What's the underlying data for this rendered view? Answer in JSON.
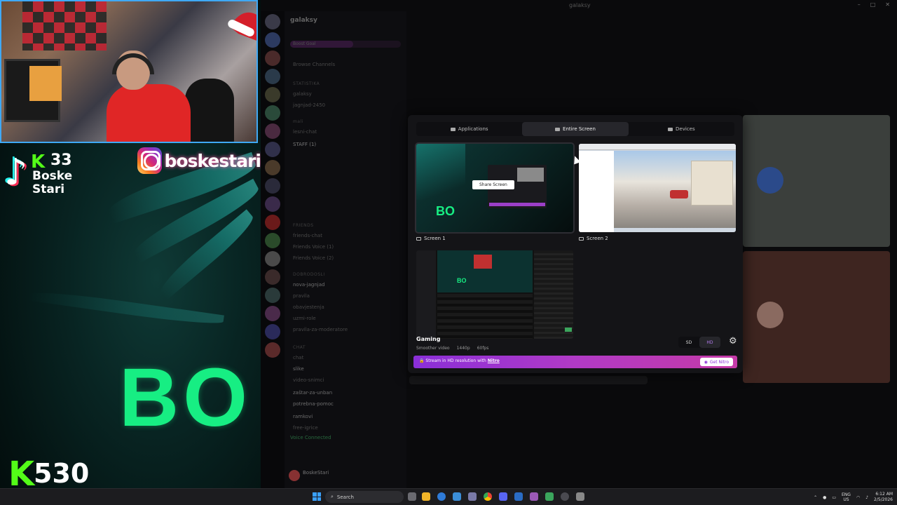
{
  "overlay": {
    "tiktok_logo": "♪",
    "tiktok_k": "K",
    "tiktok_count": "33",
    "tiktok_name": "Boske Stari",
    "instagram_handle": "boskestari",
    "big_logo": "BO",
    "kick_k": "K",
    "kick_count": "530",
    "kick_name": "boskestari",
    "accent_green": "#17ee83"
  },
  "discord": {
    "window_title": "galaksy",
    "server_name": "galaksy",
    "boost_goal": "Boost Goal",
    "channels": [
      "Browse Channels",
      "STATISTIKA",
      "galaksy",
      "jagnjad-2450",
      "mali",
      "lesni-chat",
      "STAFF (1)",
      "FRIENDS",
      "friends-chat",
      "Friends Voice (1)",
      "Friends Voice (2)",
      "DOBRODOSLI",
      "nova-jagnjad",
      "pravila",
      "obavjestenja",
      "uzmi-role",
      "pravila-za-moderatore",
      "CHAT",
      "chat",
      "slike",
      "video-snimci",
      "zaštar-za-unban",
      "potrebna-pomoc",
      "ramkovi",
      "free-igrice"
    ],
    "voice_status": "Voice Connected",
    "user_name": "BoskeStari"
  },
  "modal": {
    "tabs": [
      {
        "label": "Applications",
        "active": false
      },
      {
        "label": "Entire Screen",
        "active": true
      },
      {
        "label": "Devices",
        "active": false
      }
    ],
    "share_button": "Share Screen",
    "screens": [
      {
        "label": "Screen 1",
        "selected": true
      },
      {
        "label": "Screen 2",
        "selected": false
      }
    ],
    "thumb1_logo": "BO",
    "thumb3_logo": "BO",
    "preset": {
      "label": "Gaming",
      "subtitle": "Smoother video",
      "resolution": "1440p",
      "fps": "60fps"
    },
    "quality_sd": "SD",
    "quality_hd": "HD",
    "nitro_text_prefix": "Stream in HD resolution with",
    "nitro_link": "Nitro",
    "get_nitro": "Get Nitro",
    "nitro_color": "#b13ac6"
  },
  "taskbar": {
    "search_placeholder": "Search",
    "lang_line1": "ENG",
    "lang_line2": "US",
    "time": "6:12 AM",
    "date": "2/5/2026"
  }
}
